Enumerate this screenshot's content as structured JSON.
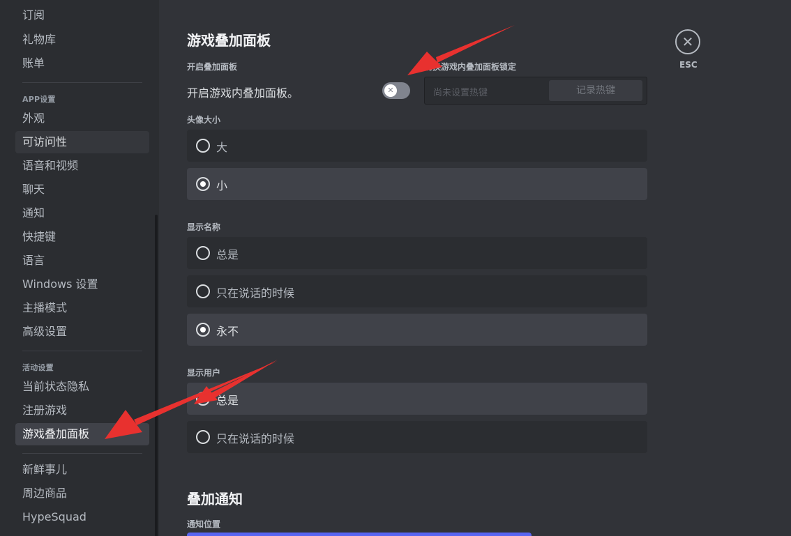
{
  "sidebar": {
    "items_top": [
      "订阅",
      "礼物库",
      "账单"
    ],
    "section_app": "APP设置",
    "items_app": [
      "外观",
      "可访问性",
      "语音和视频",
      "聊天",
      "通知",
      "快捷键",
      "语言",
      "Windows 设置",
      "主播模式",
      "高级设置"
    ],
    "section_activity": "活动设置",
    "items_activity": [
      "当前状态隐私",
      "注册游戏",
      "游戏叠加面板"
    ],
    "items_bottom": [
      "新鲜事儿",
      "周边商品",
      "HypeSquad"
    ],
    "active_item": "游戏叠加面板"
  },
  "content": {
    "title": "游戏叠加面板",
    "enable_label": "开启叠加面板",
    "enable_desc": "开启游戏内叠加面板。",
    "enable_toggle_on": false,
    "lock_label": "切换游戏内叠加面板锁定",
    "keybind_placeholder": "尚未设置热键",
    "keybind_button": "记录热键",
    "avatar_size": {
      "label": "头像大小",
      "options": [
        "大",
        "小"
      ],
      "selected": "小"
    },
    "display_names": {
      "label": "显示名称",
      "options": [
        "总是",
        "只在说话的时候",
        "永不"
      ],
      "selected": "永不"
    },
    "display_users": {
      "label": "显示用户",
      "options": [
        "总是",
        "只在说话的时候"
      ],
      "selected": "总是"
    },
    "notif_title": "叠加通知",
    "notif_position_label": "通知位置"
  },
  "close": {
    "icon": "close-icon",
    "label": "ESC"
  },
  "colors": {
    "sidebar_bg": "#2b2d31",
    "content_bg": "#313338",
    "arrow": "#e8312f",
    "accent": "#5865f2"
  }
}
